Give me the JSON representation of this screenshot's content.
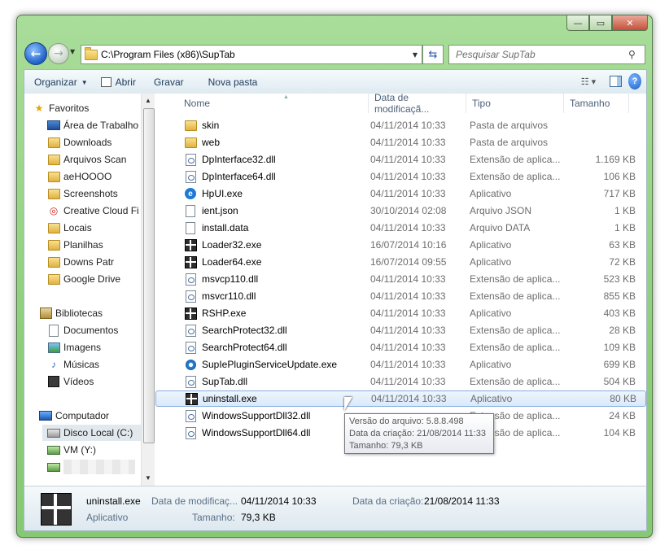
{
  "address": {
    "path": "C:\\Program Files (x86)\\SupTab"
  },
  "search": {
    "placeholder": "Pesquisar SupTab"
  },
  "toolbar": {
    "organize": "Organizar",
    "open": "Abrir",
    "burn": "Gravar",
    "new_folder": "Nova pasta"
  },
  "nav": {
    "favorites": "Favoritos",
    "fav_items": [
      "Área de Trabalho",
      "Downloads",
      "Arquivos Scan",
      "aeHOOOO",
      "Screenshots",
      "Creative Cloud Fi",
      "Locais",
      "Planilhas",
      "Downs Patr",
      "Google Drive"
    ],
    "libraries": "Bibliotecas",
    "lib_items": [
      "Documentos",
      "Imagens",
      "Músicas",
      "Vídeos"
    ],
    "computer": "Computador",
    "comp_items": [
      "Disco Local (C:)",
      "VM (Y:)"
    ]
  },
  "columns": {
    "name": "Nome",
    "date": "Data de modificaçã...",
    "type": "Tipo",
    "size": "Tamanho"
  },
  "files": [
    {
      "name": "skin",
      "date": "04/11/2014 10:33",
      "type": "Pasta de arquivos",
      "size": "",
      "icon": "folder-icon"
    },
    {
      "name": "web",
      "date": "04/11/2014 10:33",
      "type": "Pasta de arquivos",
      "size": "",
      "icon": "folder-icon"
    },
    {
      "name": "DpInterface32.dll",
      "date": "04/11/2014 10:33",
      "type": "Extensão de aplica...",
      "size": "1.169 KB",
      "icon": "dll-icon"
    },
    {
      "name": "DpInterface64.dll",
      "date": "04/11/2014 10:33",
      "type": "Extensão de aplica...",
      "size": "106 KB",
      "icon": "dll-icon"
    },
    {
      "name": "HpUI.exe",
      "date": "04/11/2014 10:33",
      "type": "Aplicativo",
      "size": "717 KB",
      "icon": "ie-icon"
    },
    {
      "name": "ient.json",
      "date": "30/10/2014 02:08",
      "type": "Arquivo JSON",
      "size": "1 KB",
      "icon": "file-icon"
    },
    {
      "name": "install.data",
      "date": "04/11/2014 10:33",
      "type": "Arquivo DATA",
      "size": "1 KB",
      "icon": "file-icon"
    },
    {
      "name": "Loader32.exe",
      "date": "16/07/2014 10:16",
      "type": "Aplicativo",
      "size": "63 KB",
      "icon": "exe-icon"
    },
    {
      "name": "Loader64.exe",
      "date": "16/07/2014 09:55",
      "type": "Aplicativo",
      "size": "72 KB",
      "icon": "exe-icon"
    },
    {
      "name": "msvcp110.dll",
      "date": "04/11/2014 10:33",
      "type": "Extensão de aplica...",
      "size": "523 KB",
      "icon": "dll-icon"
    },
    {
      "name": "msvcr110.dll",
      "date": "04/11/2014 10:33",
      "type": "Extensão de aplica...",
      "size": "855 KB",
      "icon": "dll-icon"
    },
    {
      "name": "RSHP.exe",
      "date": "04/11/2014 10:33",
      "type": "Aplicativo",
      "size": "403 KB",
      "icon": "exe-icon"
    },
    {
      "name": "SearchProtect32.dll",
      "date": "04/11/2014 10:33",
      "type": "Extensão de aplica...",
      "size": "28 KB",
      "icon": "dll-icon"
    },
    {
      "name": "SearchProtect64.dll",
      "date": "04/11/2014 10:33",
      "type": "Extensão de aplica...",
      "size": "109 KB",
      "icon": "dll-icon"
    },
    {
      "name": "SupIePluginServiceUpdate.exe",
      "date": "04/11/2014 10:33",
      "type": "Aplicativo",
      "size": "699 KB",
      "icon": "sup-icon"
    },
    {
      "name": "SupTab.dll",
      "date": "04/11/2014 10:33",
      "type": "Extensão de aplica...",
      "size": "504 KB",
      "icon": "dll-icon"
    },
    {
      "name": "uninstall.exe",
      "date": "04/11/2014 10:33",
      "type": "Aplicativo",
      "size": "80 KB",
      "icon": "exe-icon"
    },
    {
      "name": "WindowsSupportDll32.dll",
      "date": "",
      "type": "Extensão de aplica...",
      "size": "24 KB",
      "icon": "dll-icon"
    },
    {
      "name": "WindowsSupportDll64.dll",
      "date": "",
      "type": "Extensão de aplica...",
      "size": "104 KB",
      "icon": "dll-icon"
    }
  ],
  "tooltip": {
    "line1": "Versão do arquivo: 5.8.8.498",
    "line2": "Data da criação: 21/08/2014 11:33",
    "line3": "Tamanho: 79,3 KB"
  },
  "details": {
    "name": "uninstall.exe",
    "kind": "Aplicativo",
    "modified_label": "Data de modificaç...",
    "modified_value": "04/11/2014 10:33",
    "created_label": "Data da criação:",
    "created_value": "21/08/2014 11:33",
    "size_label": "Tamanho:",
    "size_value": "79,3 KB"
  }
}
